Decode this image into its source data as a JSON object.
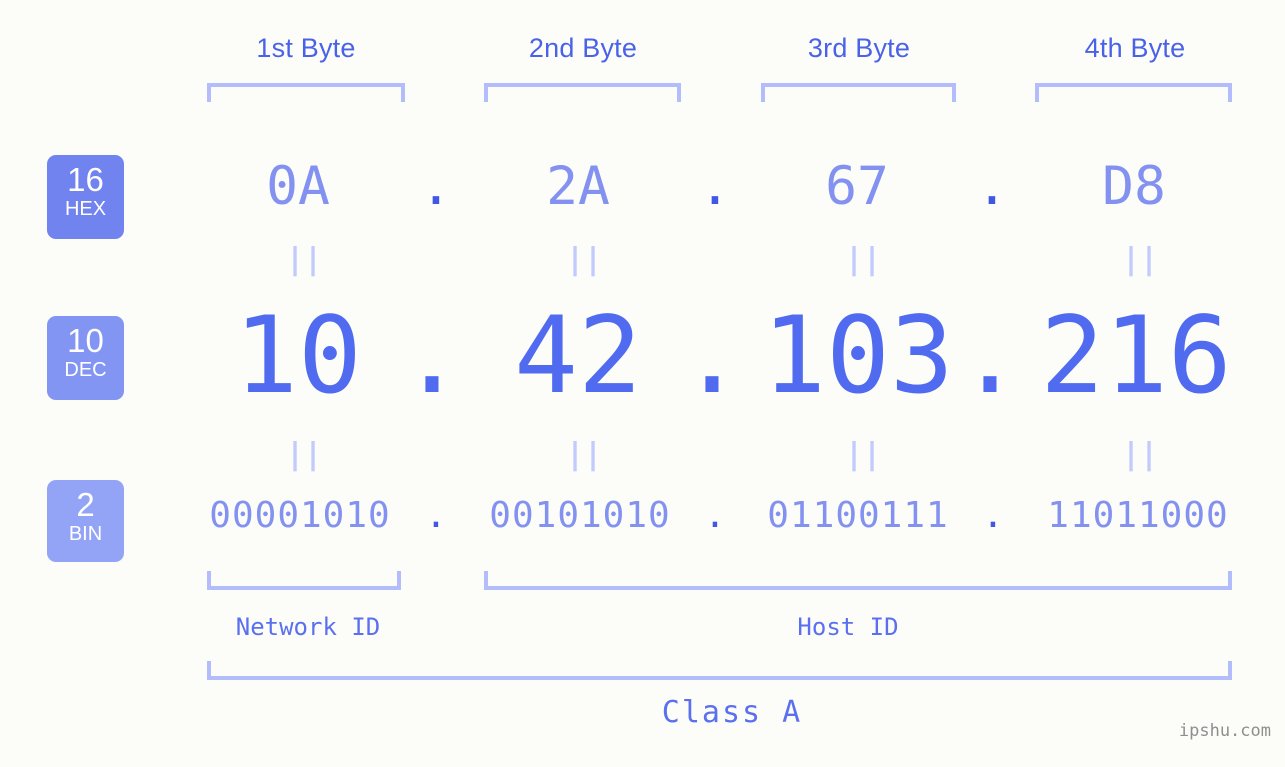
{
  "page": {
    "background": "#fcfdf9",
    "watermark": "ipshu.com"
  },
  "colors": {
    "header_blue": "#4a62e8",
    "bracket_blue": "#b3bdfb",
    "hex_text": "#8391f0",
    "dec_text": "#506bef",
    "bin_text": "#8391f0",
    "badge_hex": "#7183ee",
    "badge_dec": "#8395f2",
    "badge_bin": "#93a4f7",
    "equals_mark": "#c3cbfc",
    "label_blue": "#5b70ef"
  },
  "byte_headers": [
    {
      "label": "1st Byte"
    },
    {
      "label": "2nd Byte"
    },
    {
      "label": "3rd Byte"
    },
    {
      "label": "4th Byte"
    }
  ],
  "bases": [
    {
      "number": "16",
      "name": "HEX"
    },
    {
      "number": "10",
      "name": "DEC"
    },
    {
      "number": "2",
      "name": "BIN"
    }
  ],
  "separator": ".",
  "equals_mark": "||",
  "rows": {
    "hex": {
      "values": [
        "0A",
        "2A",
        "67",
        "D8"
      ]
    },
    "dec": {
      "values": [
        "10",
        "42",
        "103",
        "216"
      ]
    },
    "bin": {
      "values": [
        "00001010",
        "00101010",
        "01100111",
        "11011000"
      ]
    }
  },
  "segments": [
    {
      "label": "Network ID"
    },
    {
      "label": "Host ID"
    }
  ],
  "class": {
    "label": "Class A"
  }
}
